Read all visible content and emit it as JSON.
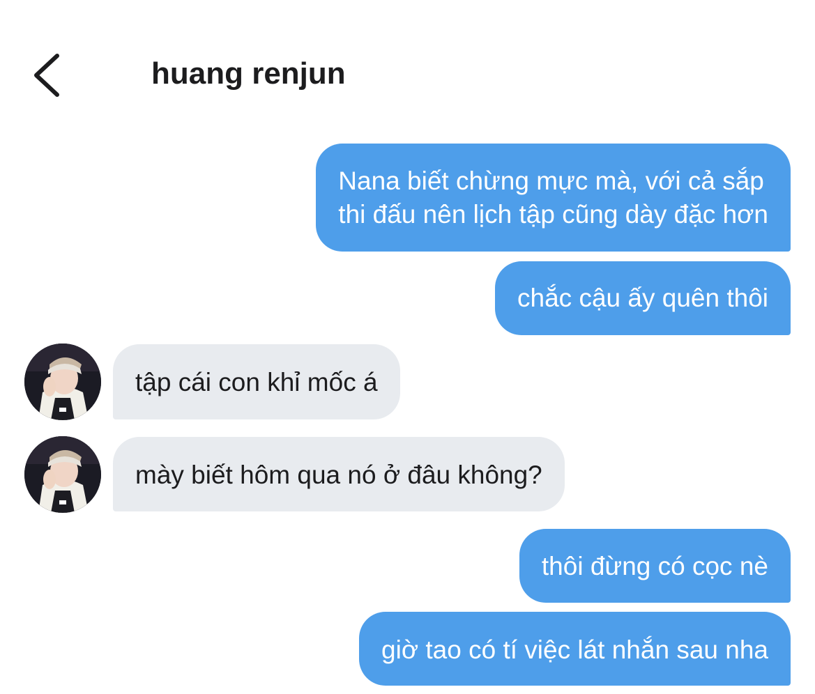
{
  "header": {
    "title": "huang renjun",
    "back_icon": "chevron-left-icon"
  },
  "messages": [
    {
      "direction": "outgoing",
      "lines": [
        "Nana biết chừng mực mà, với cả sắp",
        "thi đấu nên lịch tập cũng dày đặc hơn"
      ]
    },
    {
      "direction": "outgoing",
      "lines": [
        "chắc cậu ấy quên thôi"
      ]
    },
    {
      "direction": "incoming",
      "lines": [
        "tập cái con khỉ mốc á"
      ]
    },
    {
      "direction": "incoming",
      "lines": [
        "mày biết hôm qua nó ở đâu không?"
      ]
    },
    {
      "direction": "outgoing",
      "lines": [
        "thôi đừng có cọc nè"
      ]
    },
    {
      "direction": "outgoing",
      "lines": [
        "giờ tao có tí việc lát nhắn sau nha"
      ]
    }
  ],
  "colors": {
    "outgoing_bubble": "#4e9eea",
    "incoming_bubble": "#e8ebef",
    "outgoing_text": "#ffffff",
    "incoming_text": "#1c1c1e"
  }
}
